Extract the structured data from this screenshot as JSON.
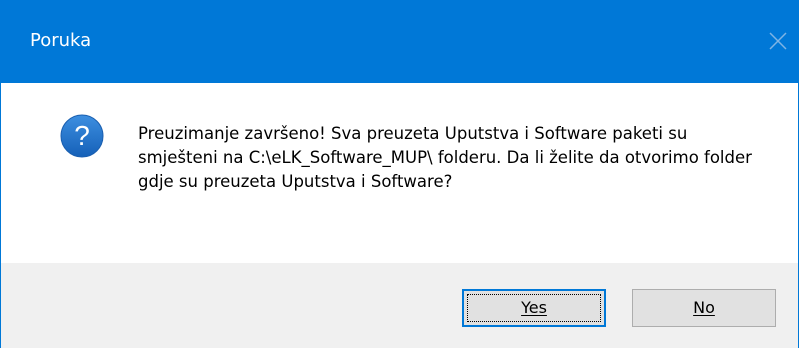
{
  "window": {
    "title": "Poruka"
  },
  "dialog": {
    "icon": "question-icon",
    "message": "Preuzimanje završeno! Sva preuzeta Uputstva i Software paketi su smješteni na C:\\eLK_Software_MUP\\ folderu. Da li želite da otvorimo folder gdje su preuzeta Uputstva i Software?"
  },
  "buttons": {
    "yes_label": "Yes",
    "no_label": "No"
  },
  "colors": {
    "titlebar": "#0078d7",
    "footer": "#f0f0f0",
    "icon": "#1a6fc9"
  }
}
